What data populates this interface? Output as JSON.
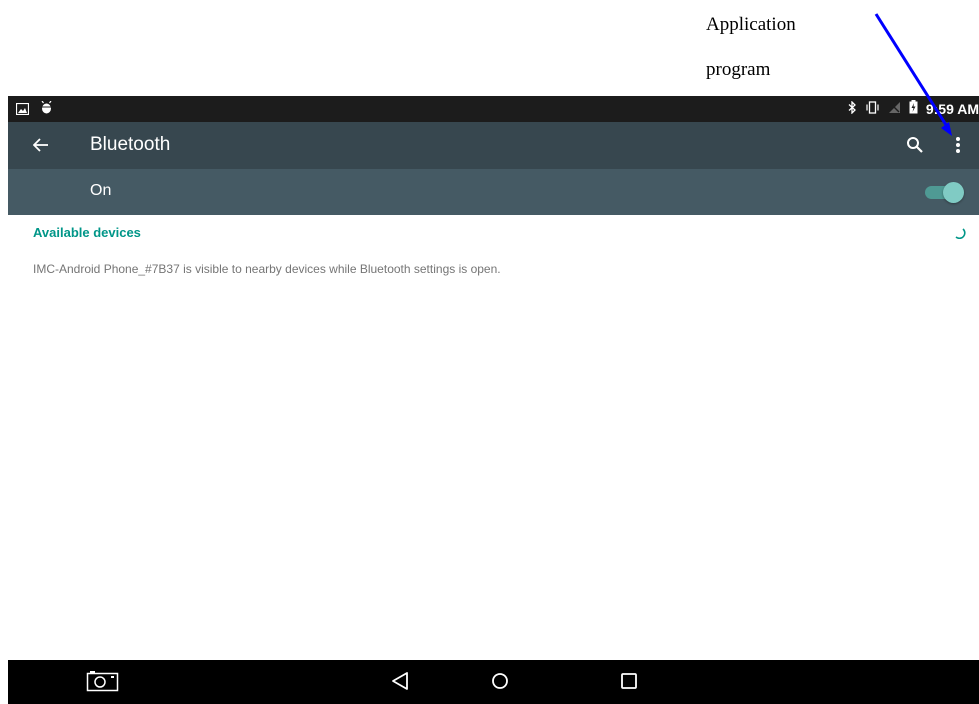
{
  "annotation": {
    "line1": "Application",
    "line2": "program"
  },
  "status_bar": {
    "left_icons": [
      "image-notification-icon",
      "android-debug-icon"
    ],
    "right_icons": [
      "bluetooth-icon",
      "vibrate-icon",
      "no-signal-icon",
      "battery-charging-icon"
    ],
    "time": "9:59 AM"
  },
  "app_bar": {
    "title": "Bluetooth",
    "back_icon": "arrow-left-icon",
    "search_icon": "search-icon",
    "more_icon": "more-vert-icon"
  },
  "switch_bar": {
    "label": "On",
    "state": true
  },
  "content": {
    "section_header": "Available devices",
    "info_text": "IMC-Android Phone_#7B37 is visible to nearby devices while Bluetooth settings is open."
  },
  "nav_bar": {
    "buttons": [
      "screenshot-icon",
      "back-triangle-icon",
      "home-circle-icon",
      "recents-square-icon"
    ]
  },
  "colors": {
    "status_bar": "#1c1c1c",
    "app_bar": "#37474f",
    "switch_bar": "#455a64",
    "accent": "#009688",
    "toggle_thumb": "#80cbc4",
    "nav_bar": "#000000",
    "annotation_arrow": "#0000ff"
  }
}
